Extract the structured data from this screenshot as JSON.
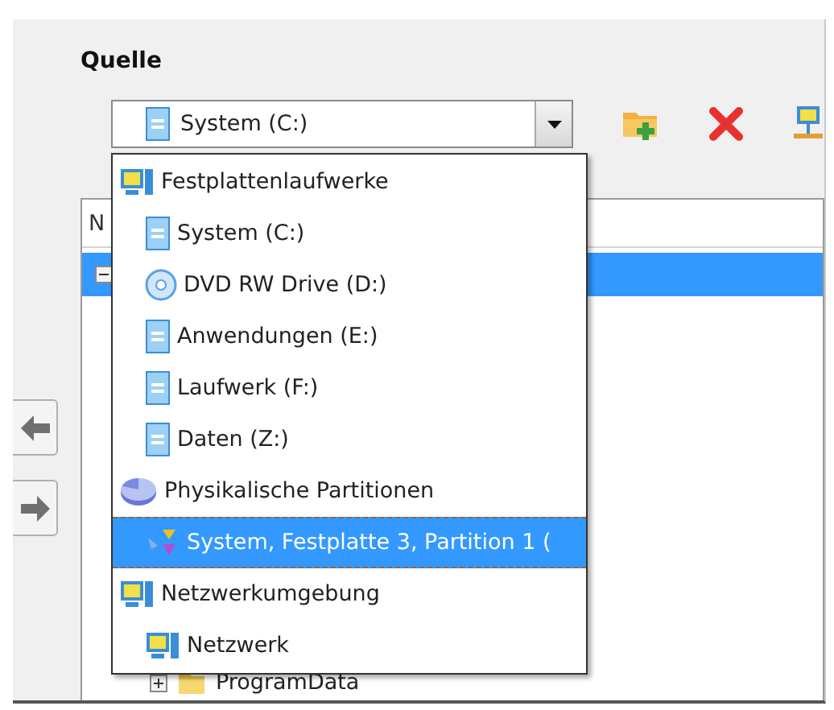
{
  "section": {
    "title": "Quelle"
  },
  "drive_select": {
    "value": "System (C:)",
    "kind": "drive",
    "expanded": true
  },
  "dropdown_groups": [
    {
      "label": "Festplattenlaufwerke",
      "kind": "computer",
      "selected": false,
      "children": [
        {
          "label": "System (C:)",
          "kind": "drive",
          "selected": false
        },
        {
          "label": "DVD RW Drive (D:)",
          "kind": "optical",
          "selected": false
        },
        {
          "label": "Anwendungen (E:)",
          "kind": "drive",
          "selected": false
        },
        {
          "label": "Laufwerk (F:)",
          "kind": "drive",
          "selected": false
        },
        {
          "label": "Daten (Z:)",
          "kind": "drive",
          "selected": false
        }
      ]
    },
    {
      "label": "Physikalische Partitionen",
      "kind": "disk",
      "selected": false,
      "children": [
        {
          "label": "System, Festplatte 3, Partition 1 (",
          "kind": "partition",
          "selected": true
        }
      ]
    },
    {
      "label": "Netzwerkumgebung",
      "kind": "computer",
      "selected": false,
      "children": [
        {
          "label": "Netzwerk",
          "kind": "computer",
          "selected": false
        }
      ]
    }
  ],
  "tree": {
    "header": "N",
    "rows": [
      {
        "selected": true,
        "expanded": true
      },
      {
        "label": "ProgramData",
        "selected": false,
        "expanded": false
      }
    ]
  }
}
